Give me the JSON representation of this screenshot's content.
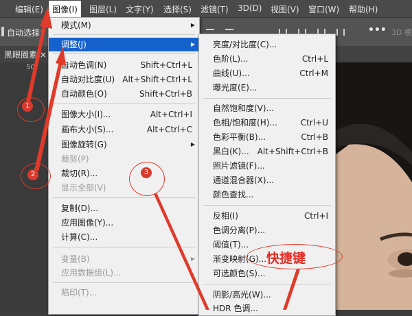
{
  "menubar": {
    "items": [
      "编辑(E)",
      "图像(I)",
      "图层(L)",
      "文字(Y)",
      "选择(S)",
      "滤镜(T)",
      "3D(D)",
      "视图(V)",
      "窗口(W)",
      "帮助(H)"
    ]
  },
  "options_bar": {
    "auto_select_label": "自动选择：",
    "mode_3d_label": "3D 模"
  },
  "doc_tab": {
    "title": "黑眼圈素 ×"
  },
  "ruler": {
    "mark_50": "50"
  },
  "image_menu": [
    {
      "label": "模式(M)",
      "submenu": true
    },
    {
      "label": "调整(J)",
      "submenu": true,
      "highlighted": true
    },
    {
      "label": "自动色调(N)",
      "shortcut": "Shift+Ctrl+L"
    },
    {
      "label": "自动对比度(U)",
      "shortcut": "Alt+Shift+Ctrl+L"
    },
    {
      "label": "自动颜色(O)",
      "shortcut": "Shift+Ctrl+B"
    },
    {
      "label": "图像大小(I)...",
      "shortcut": "Alt+Ctrl+I"
    },
    {
      "label": "画布大小(S)...",
      "shortcut": "Alt+Ctrl+C"
    },
    {
      "label": "图像旋转(G)",
      "submenu": true
    },
    {
      "label": "裁剪(P)",
      "disabled": true
    },
    {
      "label": "裁切(R)..."
    },
    {
      "label": "显示全部(V)",
      "disabled": true
    },
    {
      "label": "复制(D)..."
    },
    {
      "label": "应用图像(Y)..."
    },
    {
      "label": "计算(C)..."
    },
    {
      "label": "变量(B)",
      "disabled": true,
      "submenu": true
    },
    {
      "label": "应用数据组(L)...",
      "disabled": true
    },
    {
      "label": "陷印(T)...",
      "disabled": true
    }
  ],
  "adjust_menu": [
    {
      "label": "亮度/对比度(C)..."
    },
    {
      "label": "色阶(L)...",
      "shortcut": "Ctrl+L"
    },
    {
      "label": "曲线(U)...",
      "shortcut": "Ctrl+M"
    },
    {
      "label": "曝光度(E)..."
    },
    {
      "label": "自然饱和度(V)..."
    },
    {
      "label": "色相/饱和度(H)...",
      "shortcut": "Ctrl+U"
    },
    {
      "label": "色彩平衡(B)...",
      "shortcut": "Ctrl+B"
    },
    {
      "label": "黑白(K)...",
      "shortcut": "Alt+Shift+Ctrl+B"
    },
    {
      "label": "照片滤镜(F)..."
    },
    {
      "label": "通道混合器(X)..."
    },
    {
      "label": "颜色查找..."
    },
    {
      "label": "反相(I)",
      "shortcut": "Ctrl+I"
    },
    {
      "label": "色调分离(P)..."
    },
    {
      "label": "阈值(T)..."
    },
    {
      "label": "渐变映射(G)..."
    },
    {
      "label": "可选颜色(S)..."
    },
    {
      "label": "阴影/高光(W)..."
    },
    {
      "label": "HDR 色调..."
    }
  ],
  "annotations": {
    "markers": [
      "1",
      "2",
      "3"
    ],
    "callout_text": "快捷键",
    "color": "#e03a2b"
  }
}
